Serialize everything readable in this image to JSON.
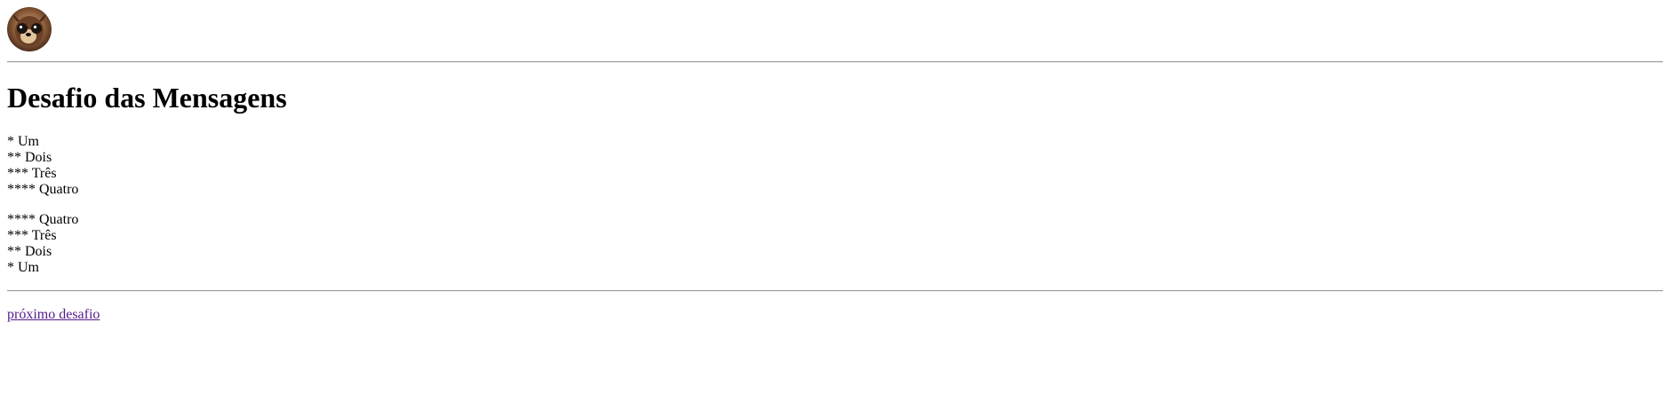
{
  "header": {
    "avatar_icon": "dog-face-photo-icon"
  },
  "main": {
    "title": "Desafio das Mensagens",
    "ascending": [
      "* Um",
      "** Dois",
      "*** Três",
      "**** Quatro"
    ],
    "descending": [
      "**** Quatro",
      "*** Três",
      "** Dois",
      "* Um"
    ]
  },
  "footer": {
    "next_link_label": "próximo desafio"
  },
  "colors": {
    "link_visited": "#551a8b",
    "rule": "#9a9a9a"
  }
}
